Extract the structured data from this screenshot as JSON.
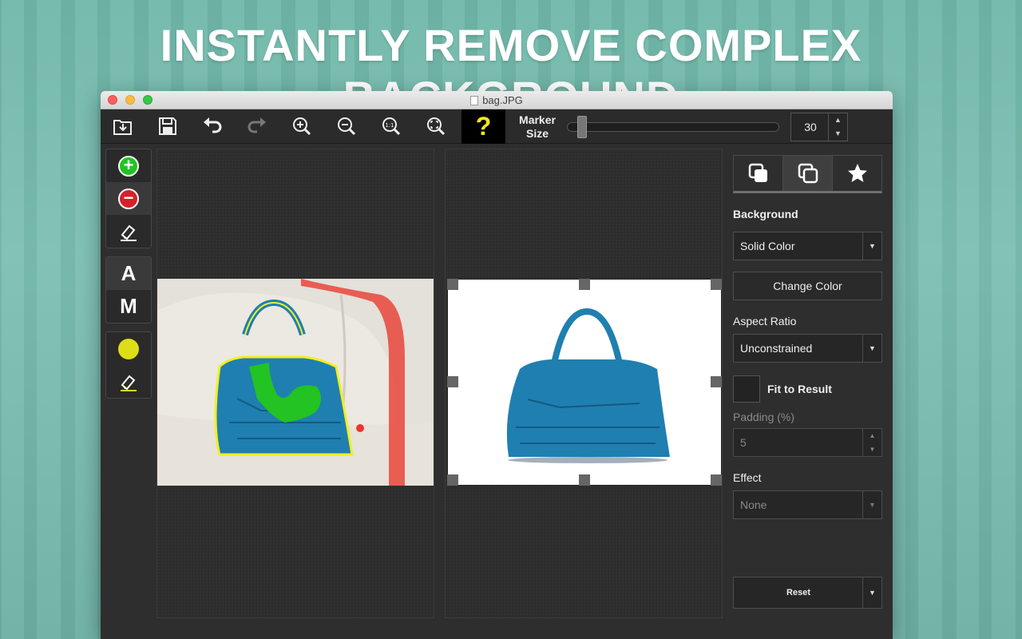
{
  "headline": "INSTANTLY REMOVE COMPLEX BACKGROUND",
  "window": {
    "title": "bag.JPG"
  },
  "toolbar": {
    "help_label": "?",
    "marker_label_line1": "Marker",
    "marker_label_line2": "Size",
    "marker_size_value": "30",
    "marker_size_fraction": 0.05
  },
  "left_tools": {
    "letter_a": "A",
    "letter_m": "M"
  },
  "right_panel": {
    "background_label": "Background",
    "background_select": "Solid Color",
    "change_color_label": "Change Color",
    "aspect_ratio_label": "Aspect Ratio",
    "aspect_ratio_select": "Unconstrained",
    "fit_to_result_label": "Fit to Result",
    "padding_label": "Padding (%)",
    "padding_value": "5",
    "effect_label": "Effect",
    "effect_select": "None",
    "reset_label": "Reset"
  },
  "colors": {
    "keep_marker": "#22c322",
    "remove_marker": "#e8372f",
    "outline": "#f2ef1f",
    "help_accent": "#f5e61a",
    "bag_blue": "#1f7fb0"
  }
}
